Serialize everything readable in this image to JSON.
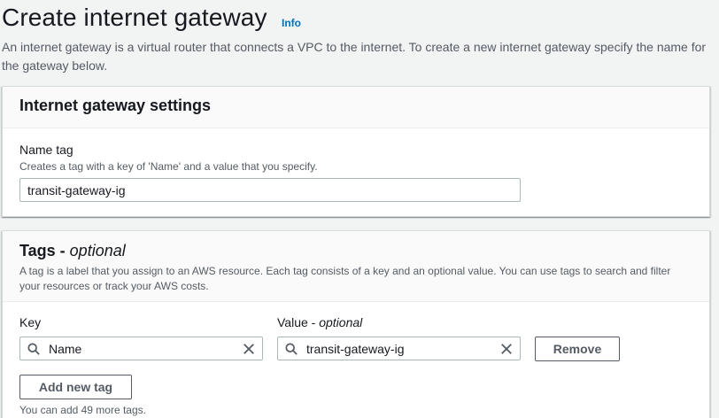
{
  "header": {
    "title": "Create internet gateway",
    "info_label": "Info",
    "description": "An internet gateway is a virtual router that connects a VPC to the internet. To create a new internet gateway specify the name for the gateway below."
  },
  "settings_panel": {
    "title": "Internet gateway settings",
    "name_tag": {
      "label": "Name tag",
      "description": "Creates a tag with a key of 'Name' and a value that you specify.",
      "value": "transit-gateway-ig"
    }
  },
  "tags_panel": {
    "title_main": "Tags - ",
    "title_optional": "optional",
    "description": "A tag is a label that you assign to an AWS resource. Each tag consists of a key and an optional value. You can use tags to search and filter your resources or track your AWS costs.",
    "key_label": "Key",
    "value_label_main": "Value - ",
    "value_label_optional": "optional",
    "rows": [
      {
        "key": "Name",
        "value": "transit-gateway-ig",
        "remove_label": "Remove"
      }
    ],
    "add_tag_label": "Add new tag",
    "limit_text": "You can add 49 more tags."
  },
  "icons": {
    "search": "search-icon",
    "clear": "close-icon"
  },
  "colors": {
    "link": "#0073bb",
    "background": "#f2f3f3",
    "text_primary": "#16191f",
    "text_secondary": "#545b64"
  }
}
